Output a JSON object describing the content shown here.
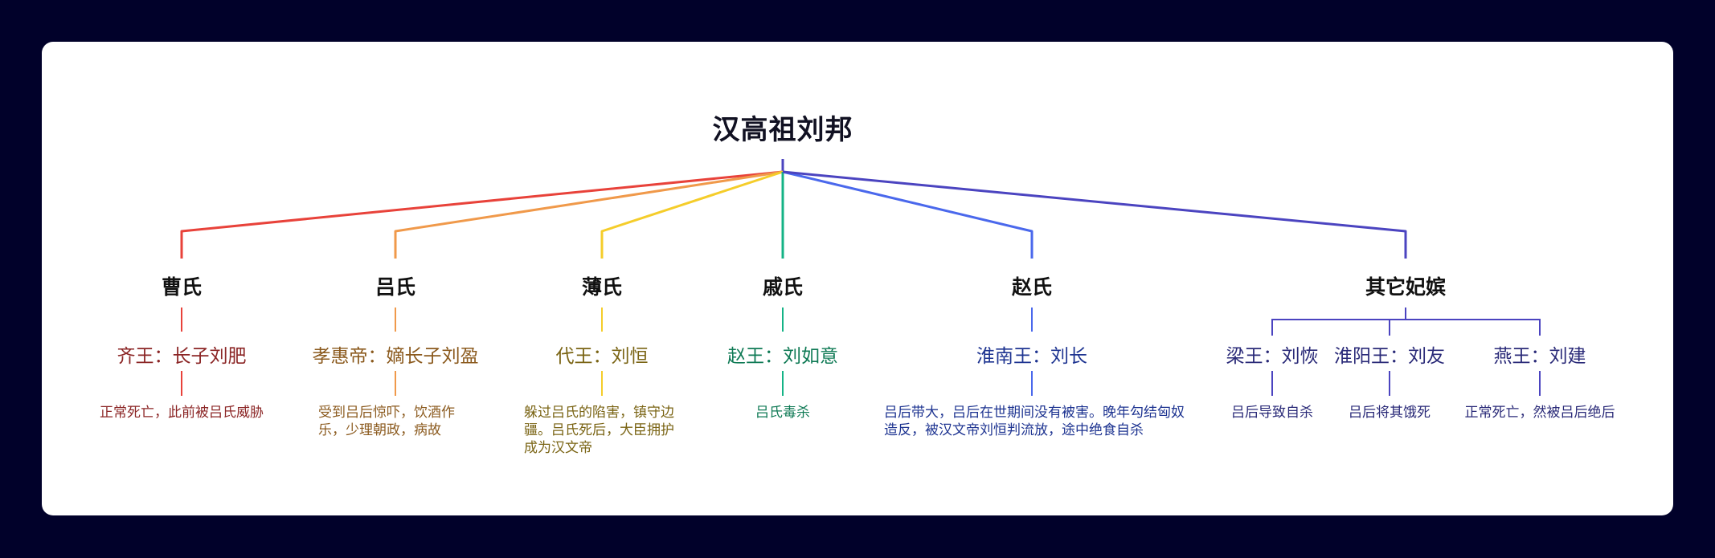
{
  "title": "汉高祖刘邦",
  "branches": [
    {
      "consort": "曹氏",
      "color": "#e8423a",
      "textColor": "#8b2525",
      "sons": [
        {
          "name": "齐王：长子刘肥",
          "note": "正常死亡，此前被吕氏威胁"
        }
      ]
    },
    {
      "consort": "吕氏",
      "color": "#f0994a",
      "textColor": "#8b5a1e",
      "sons": [
        {
          "name": "孝惠帝：嫡长子刘盈",
          "note": "受到吕后惊吓，饮酒作乐，少理朝政，病故"
        }
      ]
    },
    {
      "consort": "薄氏",
      "color": "#f5cd2a",
      "textColor": "#7a6414",
      "sons": [
        {
          "name": "代王：刘恒",
          "note": "躲过吕氏的陷害，镇守边疆。吕氏死后，大臣拥护成为汉文帝"
        }
      ]
    },
    {
      "consort": "戚氏",
      "color": "#14b386",
      "textColor": "#0f7a55",
      "sons": [
        {
          "name": "赵王：刘如意",
          "note": "吕氏毒杀"
        }
      ]
    },
    {
      "consort": "赵氏",
      "color": "#4a68ec",
      "textColor": "#1e3491",
      "sons": [
        {
          "name": "淮南王：刘长",
          "note": "吕后带大，吕后在世期间没有被害。晚年勾结匈奴造反，被汉文帝刘恒判流放，途中绝食自杀"
        }
      ]
    },
    {
      "consort": "其它妃嫔",
      "color": "#4b44c0",
      "textColor": "#2a2a78",
      "sons": [
        {
          "name": "梁王：刘恢",
          "note": "吕后导致自杀"
        },
        {
          "name": "淮阳王：刘友",
          "note": "吕后将其饿死"
        },
        {
          "name": "燕王：刘建",
          "note": "正常死亡，然被吕后绝后"
        }
      ]
    }
  ]
}
